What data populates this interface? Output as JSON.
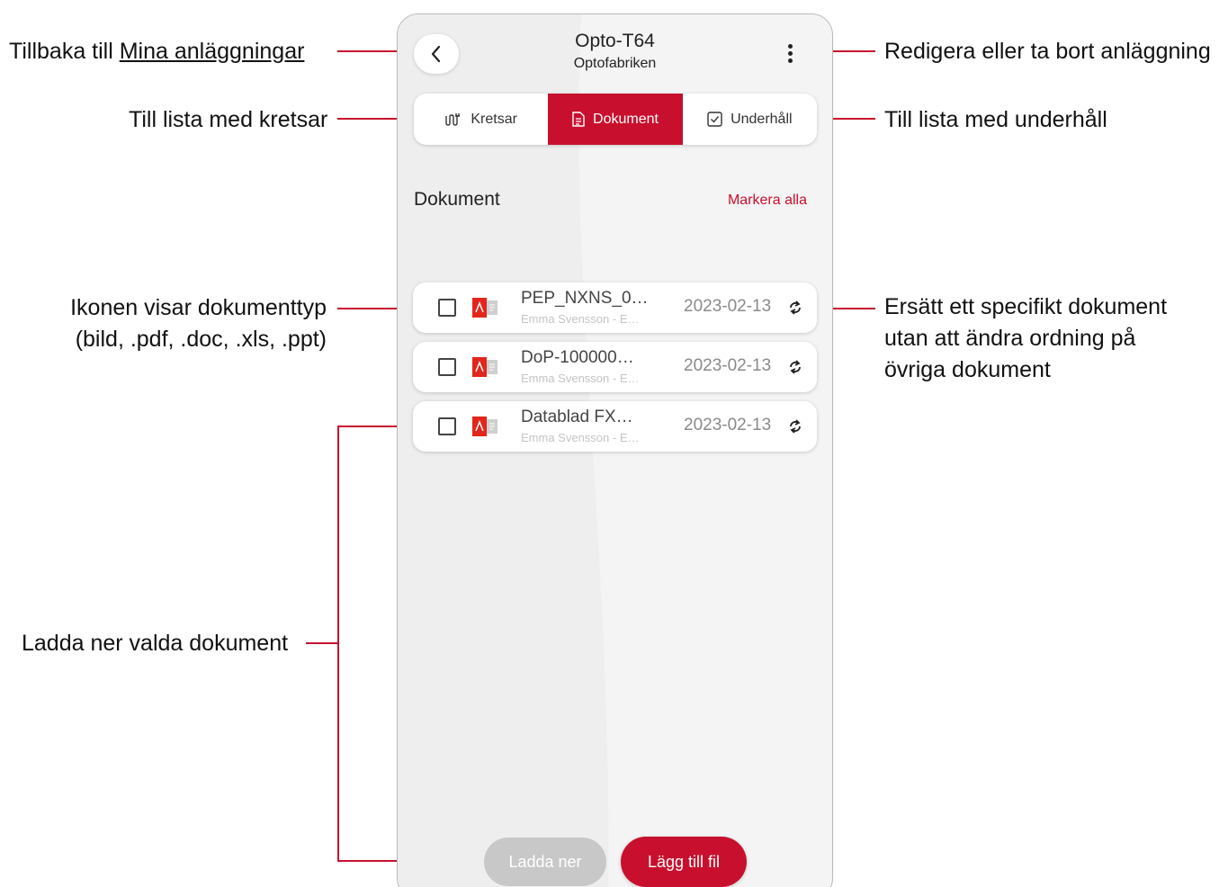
{
  "annotations": {
    "back_prefix": "Tillbaka till ",
    "back_link": "Mina anläggningar",
    "circuits_list": "Till lista med kretsar",
    "icon_type_line1": "Ikonen visar dokumenttyp",
    "icon_type_line2": "(bild, .pdf, .doc, .xls, .ppt)",
    "download_selected": "Ladda ner valda dokument",
    "edit_or_delete": "Redigera eller ta bort anläggning",
    "maintenance_list": "Till lista med underhåll",
    "replace_line1": "Ersätt ett specifikt dokument",
    "replace_line2": "utan att ändra ordning på",
    "replace_line3": "övriga dokument"
  },
  "header": {
    "title": "Opto-T64",
    "subtitle": "Optofabriken"
  },
  "tabs": [
    {
      "label": "Kretsar",
      "icon": "circuit-icon",
      "active": false
    },
    {
      "label": "Dokument",
      "icon": "document-icon",
      "active": true
    },
    {
      "label": "Underhåll",
      "icon": "checkbox-icon",
      "active": false
    }
  ],
  "documents_section": {
    "title": "Dokument",
    "select_all": "Markera alla"
  },
  "documents": [
    {
      "name": "PEP_NXNS_0…",
      "meta": "Emma Svensson - E…",
      "date": "2023-02-13",
      "type_icon": "pdf-icon"
    },
    {
      "name": "DoP-100000…",
      "meta": "Emma Svensson - E…",
      "date": "2023-02-13",
      "type_icon": "pdf-icon"
    },
    {
      "name": "Datablad FX…",
      "meta": "Emma Svensson - E…",
      "date": "2023-02-13",
      "type_icon": "pdf-icon"
    }
  ],
  "buttons": {
    "download": "Ladda ner",
    "add_file": "Lägg till fil"
  },
  "colors": {
    "accent": "#c8102e",
    "disabled": "#c8c8c8",
    "background": "#f4f4f4"
  }
}
